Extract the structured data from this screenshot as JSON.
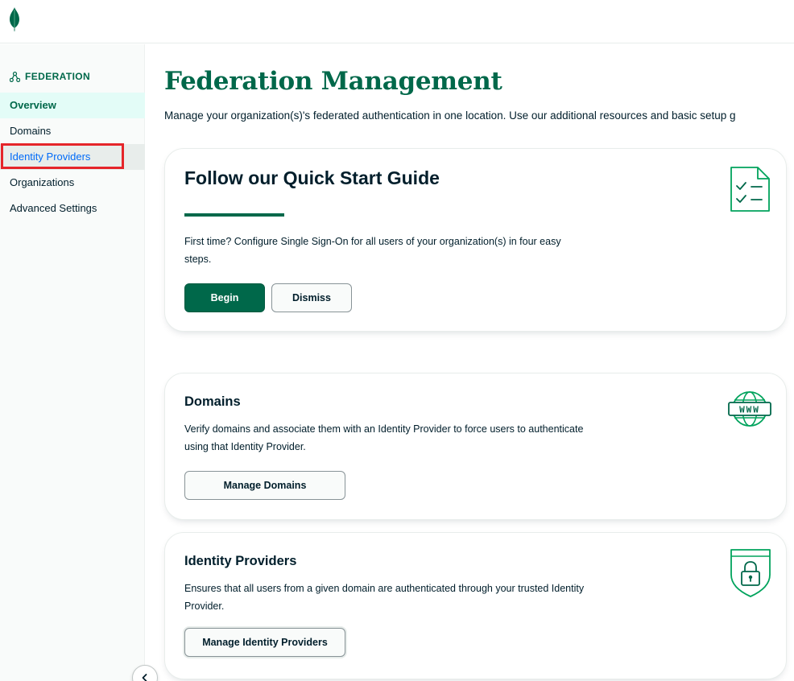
{
  "colors": {
    "brand_green": "#00684a",
    "highlight_red": "#e5252a",
    "link_blue": "#016bf8"
  },
  "topbar": {
    "logo_icon": "mongodb-leaf-icon"
  },
  "sidebar": {
    "header": {
      "icon": "federation-icon",
      "label": "FEDERATION"
    },
    "items": [
      {
        "label": "Overview",
        "state": "active"
      },
      {
        "label": "Domains",
        "state": "default"
      },
      {
        "label": "Identity Providers",
        "state": "hover"
      },
      {
        "label": "Organizations",
        "state": "default"
      },
      {
        "label": "Advanced Settings",
        "state": "default"
      }
    ],
    "collapse_icon": "chevron-left-icon"
  },
  "main": {
    "title": "Federation Management",
    "description": "Manage your organization(s)'s federated authentication in one location. Use our additional resources and basic setup g",
    "quick_start": {
      "title": "Follow our Quick Start Guide",
      "text": "First time? Configure Single Sign-On for all users of your organization(s) in four easy steps.",
      "begin_label": "Begin",
      "dismiss_label": "Dismiss",
      "icon": "checklist-document-icon"
    },
    "domains": {
      "title": "Domains",
      "text": "Verify domains and associate them with an Identity Provider to force users to authenticate using that Identity Provider.",
      "button_label": "Manage Domains",
      "icon": "www-globe-icon",
      "icon_text": "WWW"
    },
    "identity_providers": {
      "title": "Identity Providers",
      "text": "Ensures that all users from a given domain are authenticated through your trusted Identity Provider.",
      "button_label": "Manage Identity Providers",
      "icon": "shield-lock-icon"
    }
  }
}
